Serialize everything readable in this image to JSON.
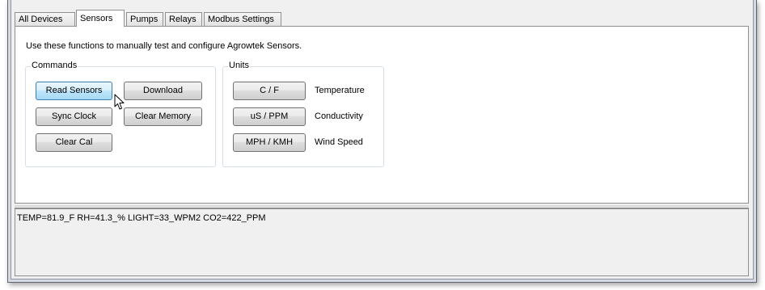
{
  "tabs": [
    {
      "label": "All Devices"
    },
    {
      "label": "Sensors"
    },
    {
      "label": "Pumps"
    },
    {
      "label": "Relays"
    },
    {
      "label": "Modbus Settings"
    }
  ],
  "active_tab": "Sensors",
  "intro_text": "Use these functions to manually test and configure Agrowtek Sensors.",
  "commands": {
    "title": "Commands",
    "read_sensors": "Read Sensors",
    "download": "Download",
    "sync_clock": "Sync Clock",
    "clear_memory": "Clear Memory",
    "clear_cal": "Clear Cal"
  },
  "units": {
    "title": "Units",
    "rows": [
      {
        "button": "C / F",
        "label": "Temperature"
      },
      {
        "button": "uS / PPM",
        "label": "Conductivity"
      },
      {
        "button": "MPH / KMH",
        "label": "Wind Speed"
      }
    ]
  },
  "output": {
    "text": "TEMP=81.9_F RH=41.3_% LIGHT=33_WPM2 CO2=422_PPM"
  },
  "colors": {
    "hover_button_border": "#3c7fb1",
    "hover_button_fill": "#bee6fd",
    "panel_background": "#ffffff",
    "window_background": "#f0f0f0"
  }
}
